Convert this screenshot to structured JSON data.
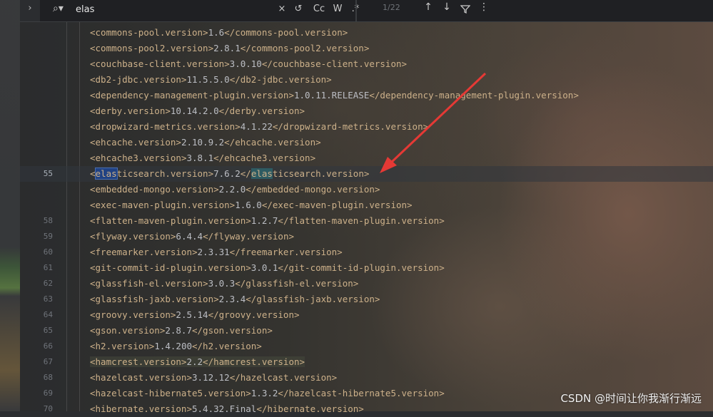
{
  "search": {
    "expand_icon": "chevron-right-icon",
    "icon": "search-icon",
    "query": "elas",
    "options": {
      "clear": "×",
      "regex_replace": "↺",
      "match_case": "Cc",
      "words": "W",
      "regex": ".*"
    },
    "match_count": "1/22",
    "nav": {
      "prev": "↑",
      "next": "↓",
      "filter": "⏚",
      "more": "⋮"
    }
  },
  "code_lines": [
    {
      "num": "",
      "pre": "<commons-pool.version>",
      "val": "1.6",
      "post": "</commons-pool.version>"
    },
    {
      "num": "",
      "pre": "<commons-pool2.version>",
      "val": "2.8.1",
      "post": "</commons-pool2.version>"
    },
    {
      "num": "",
      "pre": "<couchbase-client.version>",
      "val": "3.0.10",
      "post": "</couchbase-client.version>"
    },
    {
      "num": "",
      "pre": "<db2-jdbc.version>",
      "val": "11.5.5.0",
      "post": "</db2-jdbc.version>"
    },
    {
      "num": "",
      "pre": "<dependency-management-plugin.version>",
      "val": "1.0.11.RELEASE",
      "post": "</dependency-management-plugin.version>"
    },
    {
      "num": "",
      "pre": "<derby.version>",
      "val": "10.14.2.0",
      "post": "</derby.version>"
    },
    {
      "num": "",
      "pre": "<dropwizard-metrics.version>",
      "val": "4.1.22",
      "post": "</dropwizard-metrics.version>"
    },
    {
      "num": "",
      "pre": "<ehcache.version>",
      "val": "2.10.9.2",
      "post": "</ehcache.version>"
    },
    {
      "num": "",
      "pre": "<ehcache3.version>",
      "val": "3.8.1",
      "post": "</ehcache3.version>"
    },
    {
      "num": "55",
      "pre": "<elasticsearch.version>",
      "val": "7.6.2",
      "post": "</elasticsearch.version>",
      "current": true
    },
    {
      "num": "",
      "pre": "<embedded-mongo.version>",
      "val": "2.2.0",
      "post": "</embedded-mongo.version>"
    },
    {
      "num": "",
      "pre": "<exec-maven-plugin.version>",
      "val": "1.6.0",
      "post": "</exec-maven-plugin.version>"
    },
    {
      "num": "58",
      "pre": "<flatten-maven-plugin.version>",
      "val": "1.2.7",
      "post": "</flatten-maven-plugin.version>"
    },
    {
      "num": "59",
      "pre": "<flyway.version>",
      "val": "6.4.4",
      "post": "</flyway.version>"
    },
    {
      "num": "60",
      "pre": "<freemarker.version>",
      "val": "2.3.31",
      "post": "</freemarker.version>"
    },
    {
      "num": "61",
      "pre": "<git-commit-id-plugin.version>",
      "val": "3.0.1",
      "post": "</git-commit-id-plugin.version>"
    },
    {
      "num": "62",
      "pre": "<glassfish-el.version>",
      "val": "3.0.3",
      "post": "</glassfish-el.version>"
    },
    {
      "num": "63",
      "pre": "<glassfish-jaxb.version>",
      "val": "2.3.4",
      "post": "</glassfish-jaxb.version>"
    },
    {
      "num": "64",
      "pre": "<groovy.version>",
      "val": "2.5.14",
      "post": "</groovy.version>"
    },
    {
      "num": "65",
      "pre": "<gson.version>",
      "val": "2.8.7",
      "post": "</gson.version>"
    },
    {
      "num": "66",
      "pre": "<h2.version>",
      "val": "1.4.200",
      "post": "</h2.version>"
    },
    {
      "num": "67",
      "pre": "<hamcrest.version>",
      "val": "2.2",
      "post": "</hamcrest.version>",
      "pale": true
    },
    {
      "num": "68",
      "pre": "<hazelcast.version>",
      "val": "3.12.12",
      "post": "</hazelcast.version>"
    },
    {
      "num": "69",
      "pre": "<hazelcast-hibernate5.version>",
      "val": "1.3.2",
      "post": "</hazelcast-hibernate5.version>"
    },
    {
      "num": "70",
      "pre": "<hibernate.version>",
      "val": "5.4.32.Final",
      "post": "</hibernate.version>"
    }
  ],
  "watermark": "CSDN @时间让你我渐行渐远",
  "colors": {
    "tag": "#cdb18a",
    "text": "#bcbec4",
    "match_primary": "#214283",
    "match_secondary": "#2e5b62",
    "annotation_arrow": "#e53935"
  }
}
